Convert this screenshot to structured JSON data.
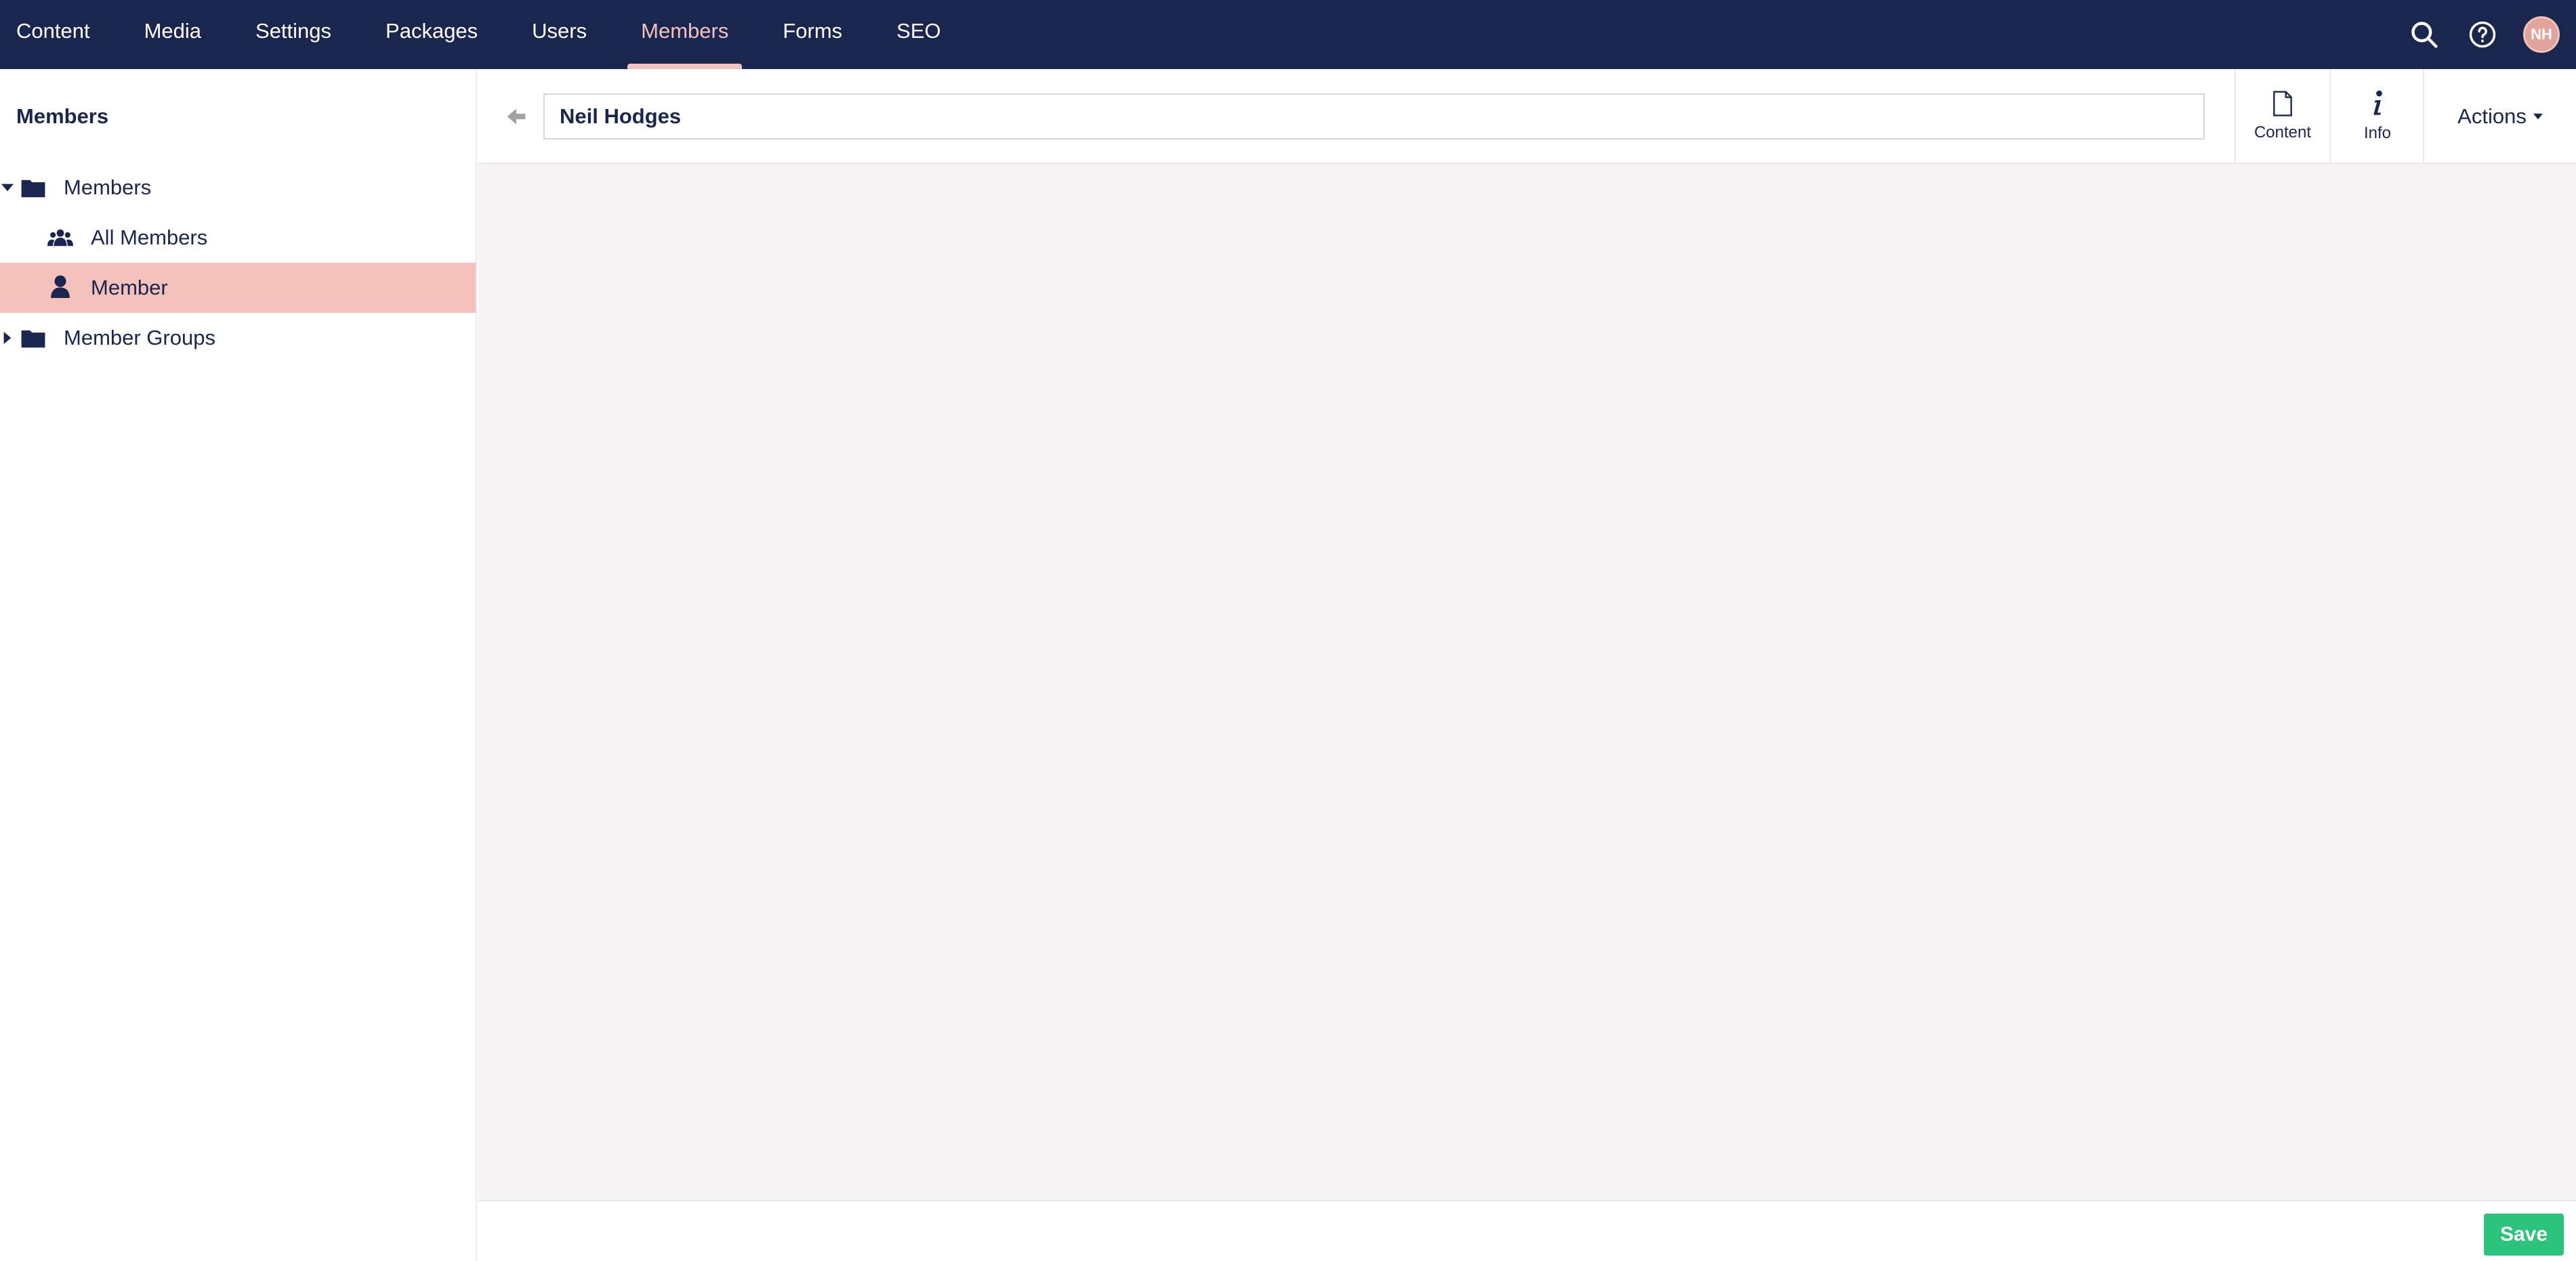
{
  "header": {
    "nav": [
      {
        "label": "Content"
      },
      {
        "label": "Media"
      },
      {
        "label": "Settings"
      },
      {
        "label": "Packages"
      },
      {
        "label": "Users"
      },
      {
        "label": "Members",
        "active": true
      },
      {
        "label": "Forms"
      },
      {
        "label": "SEO"
      }
    ],
    "avatar_initials": "NH",
    "colors": {
      "bar": "#1b264f",
      "accent": "#f5c1bc"
    }
  },
  "sidebar": {
    "title": "Members",
    "tree": [
      {
        "label": "Members",
        "icon": "folder-icon",
        "expanded": true
      },
      {
        "label": "All Members",
        "icon": "users-icon"
      },
      {
        "label": "Member",
        "icon": "user-icon",
        "selected": true
      },
      {
        "label": "Member Groups",
        "icon": "folder-icon",
        "expanded": false
      }
    ]
  },
  "editor": {
    "name_value": "Neil Hodges",
    "tabs": [
      {
        "label": "Content",
        "icon": "document-icon"
      },
      {
        "label": "Info",
        "icon": "info-icon"
      }
    ],
    "actions_label": "Actions",
    "save_label": "Save",
    "save_color": "#2bc37c"
  }
}
